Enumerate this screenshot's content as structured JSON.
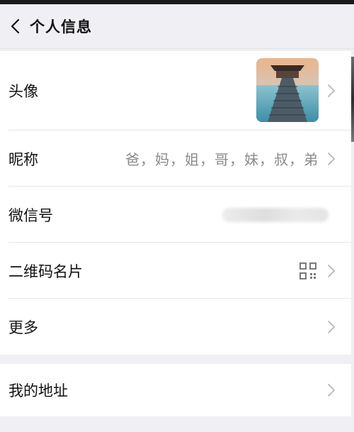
{
  "nav": {
    "title": "个人信息"
  },
  "rows": {
    "avatar": {
      "label": "头像"
    },
    "nickname": {
      "label": "昵称",
      "value": "爸，妈，姐，哥，妹，叔，弟"
    },
    "wechat_id": {
      "label": "微信号"
    },
    "qr_card": {
      "label": "二维码名片"
    },
    "more": {
      "label": "更多"
    },
    "address": {
      "label": "我的地址"
    }
  },
  "icons": {
    "back": "chevron-left-icon",
    "chevron": "chevron-right-icon",
    "qr": "qr-code-icon"
  },
  "colors": {
    "background": "#efeff4",
    "cell": "#ffffff",
    "secondary_text": "#8a8a8a"
  }
}
